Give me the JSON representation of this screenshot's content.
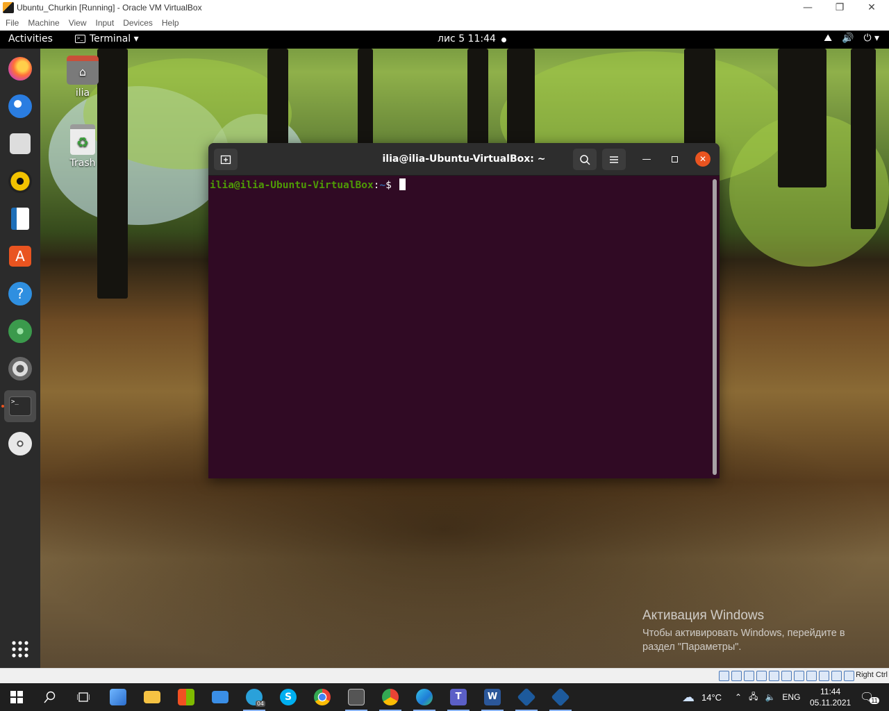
{
  "vbox": {
    "title": "Ubuntu_Churkin [Running] - Oracle VM VirtualBox",
    "menu": [
      "File",
      "Machine",
      "View",
      "Input",
      "Devices",
      "Help"
    ],
    "host_key": "Right Ctrl"
  },
  "gnome": {
    "activities": "Activities",
    "app_menu": "Terminal ▾",
    "clock": "лис 5  11:44"
  },
  "desktop": {
    "icons": [
      {
        "label": "ilia"
      },
      {
        "label": "Trash"
      }
    ]
  },
  "terminal": {
    "title": "ilia@ilia-Ubuntu-VirtualBox: ~",
    "prompt_user": "ilia@ilia-Ubuntu-VirtualBox",
    "prompt_sep": ":",
    "prompt_path": "~",
    "prompt_sign": "$ "
  },
  "watermark": {
    "heading": "Активация Windows",
    "text": "Чтобы активировать Windows, перейдите в раздел \"Параметры\"."
  },
  "tray": {
    "weather": "14°C",
    "lang": "ENG",
    "time": "11:44",
    "date": "05.11.2021",
    "notifications": "11",
    "telegram_badge": "04"
  },
  "colors": {
    "ubuntu_orange": "#e95420",
    "terminal_bg": "#300a24",
    "prompt_user": "#4e9a06",
    "prompt_path": "#3465a4"
  }
}
